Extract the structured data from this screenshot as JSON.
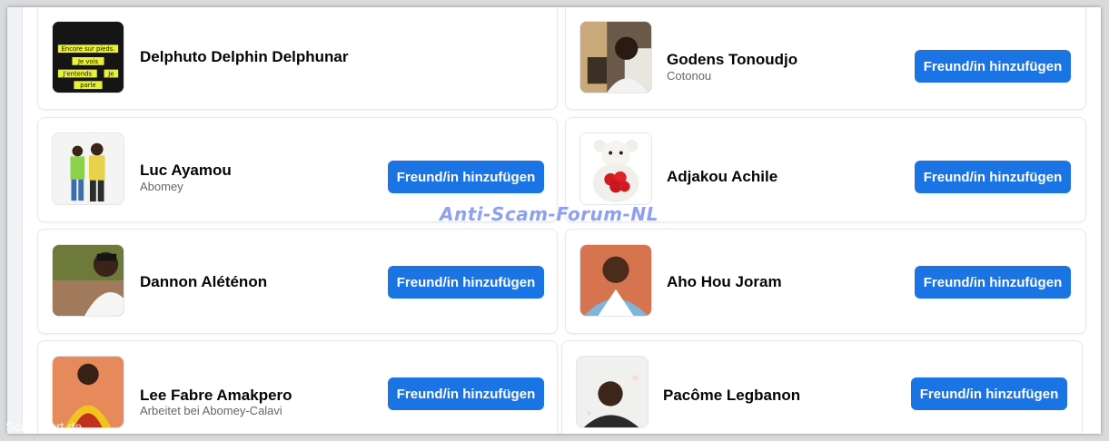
{
  "colors": {
    "button": "#1b74e4",
    "watermark": "#8fa0ee"
  },
  "watermark": "Anti-Scam-Forum-NL",
  "credit": "ScamAlert.de",
  "button_label": "Freund/in hinzufügen",
  "avatar_text": {
    "l1": "Encore sur pieds.",
    "l2": "Je vois",
    "l3": "J'entends",
    "l4": "Je",
    "l5": "parle"
  },
  "people": [
    {
      "name": "Delphuto Delphin Delphunar",
      "sub": "",
      "has_button": false
    },
    {
      "name": "Godens Tonoudjo",
      "sub": "Cotonou",
      "has_button": true
    },
    {
      "name": "Luc Ayamou",
      "sub": "Abomey",
      "has_button": true
    },
    {
      "name": "Adjakou Achile",
      "sub": "",
      "has_button": true
    },
    {
      "name": "Dannon Aléténon",
      "sub": "",
      "has_button": true
    },
    {
      "name": "Aho Hou Joram",
      "sub": "",
      "has_button": true
    },
    {
      "name": "Lee Fabre Amakpero",
      "sub": "Arbeitet bei Abomey-Calavi",
      "has_button": true
    },
    {
      "name": "Pacôme Legbanon",
      "sub": "",
      "has_button": true
    }
  ]
}
